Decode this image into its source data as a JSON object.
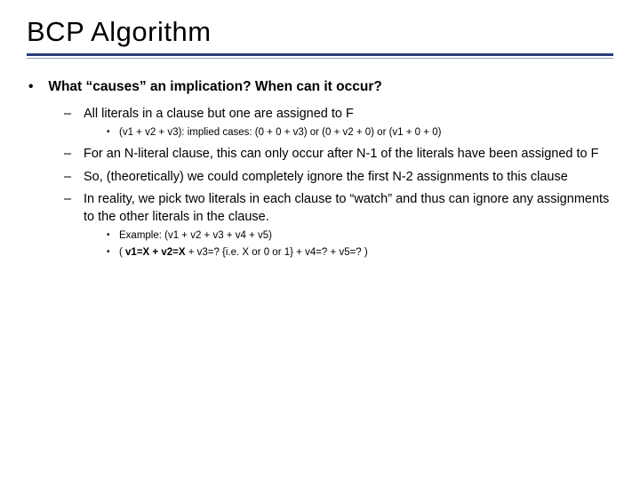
{
  "title": "BCP Algorithm",
  "bullets": {
    "q": "What “causes” an implication? When can it occur?",
    "sub": {
      "a": "All literals in a clause but one are assigned to F",
      "a_detail": "(v1 + v2 + v3): implied cases: (0 + 0 + v3) or (0 + v2 + 0) or (v1 + 0 + 0)",
      "b": "For an N-literal clause, this can only occur after N-1 of the literals have been assigned to F",
      "c": "So, (theoretically) we could completely ignore the first N-2 assignments to this clause",
      "d": "In reality, we pick two literals in each clause to “watch” and thus can ignore any assignments to the other literals in the clause.",
      "d_detail1": "Example: (v1 + v2 + v3 + v4 + v5)",
      "d_detail2_pre": "( ",
      "d_detail2_bold": "v1=X + v2=X",
      "d_detail2_post": " + v3=? {i.e. X or 0 or 1} + v4=? + v5=? )"
    }
  }
}
